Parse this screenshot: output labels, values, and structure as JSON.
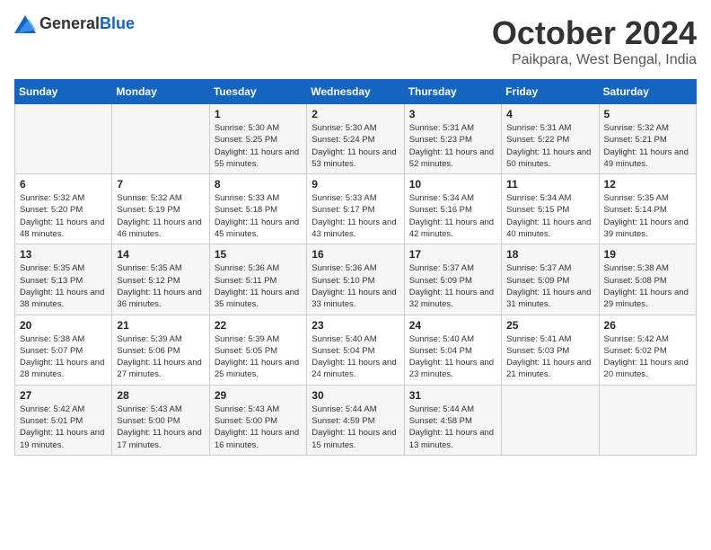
{
  "logo": {
    "general": "General",
    "blue": "Blue"
  },
  "title": {
    "month": "October 2024",
    "location": "Paikpara, West Bengal, India"
  },
  "headers": [
    "Sunday",
    "Monday",
    "Tuesday",
    "Wednesday",
    "Thursday",
    "Friday",
    "Saturday"
  ],
  "weeks": [
    [
      {
        "day": "",
        "detail": ""
      },
      {
        "day": "",
        "detail": ""
      },
      {
        "day": "1",
        "detail": "Sunrise: 5:30 AM\nSunset: 5:25 PM\nDaylight: 11 hours and 55 minutes."
      },
      {
        "day": "2",
        "detail": "Sunrise: 5:30 AM\nSunset: 5:24 PM\nDaylight: 11 hours and 53 minutes."
      },
      {
        "day": "3",
        "detail": "Sunrise: 5:31 AM\nSunset: 5:23 PM\nDaylight: 11 hours and 52 minutes."
      },
      {
        "day": "4",
        "detail": "Sunrise: 5:31 AM\nSunset: 5:22 PM\nDaylight: 11 hours and 50 minutes."
      },
      {
        "day": "5",
        "detail": "Sunrise: 5:32 AM\nSunset: 5:21 PM\nDaylight: 11 hours and 49 minutes."
      }
    ],
    [
      {
        "day": "6",
        "detail": "Sunrise: 5:32 AM\nSunset: 5:20 PM\nDaylight: 11 hours and 48 minutes."
      },
      {
        "day": "7",
        "detail": "Sunrise: 5:32 AM\nSunset: 5:19 PM\nDaylight: 11 hours and 46 minutes."
      },
      {
        "day": "8",
        "detail": "Sunrise: 5:33 AM\nSunset: 5:18 PM\nDaylight: 11 hours and 45 minutes."
      },
      {
        "day": "9",
        "detail": "Sunrise: 5:33 AM\nSunset: 5:17 PM\nDaylight: 11 hours and 43 minutes."
      },
      {
        "day": "10",
        "detail": "Sunrise: 5:34 AM\nSunset: 5:16 PM\nDaylight: 11 hours and 42 minutes."
      },
      {
        "day": "11",
        "detail": "Sunrise: 5:34 AM\nSunset: 5:15 PM\nDaylight: 11 hours and 40 minutes."
      },
      {
        "day": "12",
        "detail": "Sunrise: 5:35 AM\nSunset: 5:14 PM\nDaylight: 11 hours and 39 minutes."
      }
    ],
    [
      {
        "day": "13",
        "detail": "Sunrise: 5:35 AM\nSunset: 5:13 PM\nDaylight: 11 hours and 38 minutes."
      },
      {
        "day": "14",
        "detail": "Sunrise: 5:35 AM\nSunset: 5:12 PM\nDaylight: 11 hours and 36 minutes."
      },
      {
        "day": "15",
        "detail": "Sunrise: 5:36 AM\nSunset: 5:11 PM\nDaylight: 11 hours and 35 minutes."
      },
      {
        "day": "16",
        "detail": "Sunrise: 5:36 AM\nSunset: 5:10 PM\nDaylight: 11 hours and 33 minutes."
      },
      {
        "day": "17",
        "detail": "Sunrise: 5:37 AM\nSunset: 5:09 PM\nDaylight: 11 hours and 32 minutes."
      },
      {
        "day": "18",
        "detail": "Sunrise: 5:37 AM\nSunset: 5:09 PM\nDaylight: 11 hours and 31 minutes."
      },
      {
        "day": "19",
        "detail": "Sunrise: 5:38 AM\nSunset: 5:08 PM\nDaylight: 11 hours and 29 minutes."
      }
    ],
    [
      {
        "day": "20",
        "detail": "Sunrise: 5:38 AM\nSunset: 5:07 PM\nDaylight: 11 hours and 28 minutes."
      },
      {
        "day": "21",
        "detail": "Sunrise: 5:39 AM\nSunset: 5:06 PM\nDaylight: 11 hours and 27 minutes."
      },
      {
        "day": "22",
        "detail": "Sunrise: 5:39 AM\nSunset: 5:05 PM\nDaylight: 11 hours and 25 minutes."
      },
      {
        "day": "23",
        "detail": "Sunrise: 5:40 AM\nSunset: 5:04 PM\nDaylight: 11 hours and 24 minutes."
      },
      {
        "day": "24",
        "detail": "Sunrise: 5:40 AM\nSunset: 5:04 PM\nDaylight: 11 hours and 23 minutes."
      },
      {
        "day": "25",
        "detail": "Sunrise: 5:41 AM\nSunset: 5:03 PM\nDaylight: 11 hours and 21 minutes."
      },
      {
        "day": "26",
        "detail": "Sunrise: 5:42 AM\nSunset: 5:02 PM\nDaylight: 11 hours and 20 minutes."
      }
    ],
    [
      {
        "day": "27",
        "detail": "Sunrise: 5:42 AM\nSunset: 5:01 PM\nDaylight: 11 hours and 19 minutes."
      },
      {
        "day": "28",
        "detail": "Sunrise: 5:43 AM\nSunset: 5:00 PM\nDaylight: 11 hours and 17 minutes."
      },
      {
        "day": "29",
        "detail": "Sunrise: 5:43 AM\nSunset: 5:00 PM\nDaylight: 11 hours and 16 minutes."
      },
      {
        "day": "30",
        "detail": "Sunrise: 5:44 AM\nSunset: 4:59 PM\nDaylight: 11 hours and 15 minutes."
      },
      {
        "day": "31",
        "detail": "Sunrise: 5:44 AM\nSunset: 4:58 PM\nDaylight: 11 hours and 13 minutes."
      },
      {
        "day": "",
        "detail": ""
      },
      {
        "day": "",
        "detail": ""
      }
    ]
  ]
}
